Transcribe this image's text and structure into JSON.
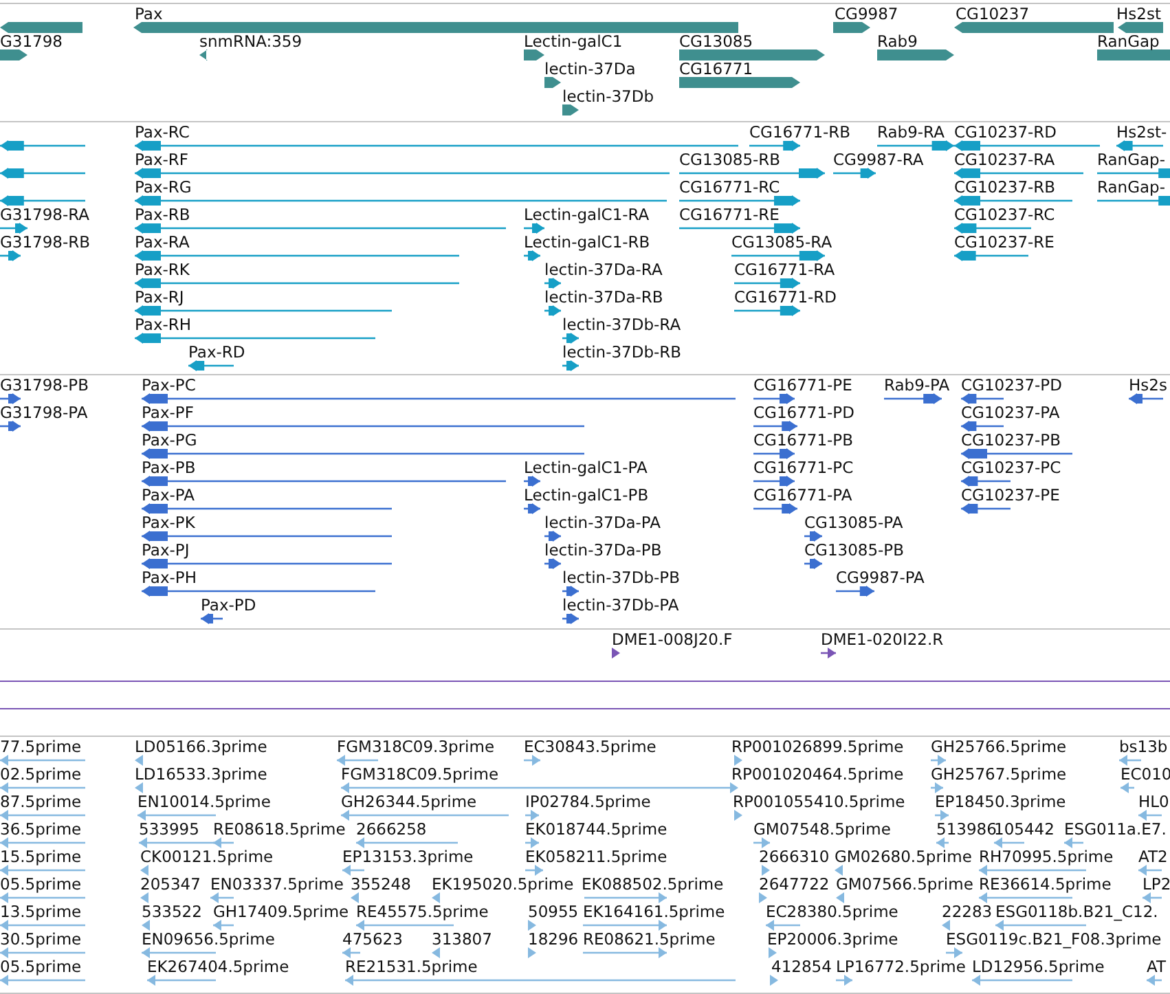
{
  "tracks": [
    {
      "kind": "gene",
      "color": "#3f8f8f",
      "features": [
        {
          "reverse": true
        },
        {
          "label": "Pax",
          "reverse": true
        },
        {
          "label": "CG9987",
          "reverse": false
        },
        {
          "label": "CG10237",
          "reverse": true
        },
        {
          "label": "Hs2st",
          "reverse": true
        },
        {
          "label": "G31798",
          "reverse": false
        },
        {
          "label": "snmRNA:359",
          "reverse": true
        },
        {
          "label": "Lectin-galC1",
          "reverse": false
        },
        {
          "label": "CG13085",
          "reverse": false
        },
        {
          "label": "Rab9",
          "reverse": false
        },
        {
          "label": "RanGap",
          "reverse": false
        },
        {
          "label": "lectin-37Da",
          "reverse": false
        },
        {
          "label": "CG16771",
          "reverse": false
        },
        {
          "label": "lectin-37Db",
          "reverse": false
        }
      ]
    },
    {
      "kind": "transcript",
      "color": "#169fc6",
      "features": [
        {
          "reverse": true
        },
        {
          "label": "Pax-RC",
          "reverse": true
        },
        {
          "label": "CG16771-RB",
          "reverse": false
        },
        {
          "label": "Rab9-RA",
          "reverse": false
        },
        {
          "label": "CG10237-RD",
          "reverse": true
        },
        {
          "label": "Hs2st-",
          "reverse": true
        },
        {
          "reverse": true
        },
        {
          "label": "Pax-RF",
          "reverse": true
        },
        {
          "label": "CG13085-RB",
          "reverse": false
        },
        {
          "label": "CG9987-RA",
          "reverse": false
        },
        {
          "label": "CG10237-RA",
          "reverse": true
        },
        {
          "label": "RanGap-",
          "reverse": false
        },
        {
          "reverse": true
        },
        {
          "label": "Pax-RG",
          "reverse": true
        },
        {
          "label": "CG16771-RC",
          "reverse": false
        },
        {
          "label": "CG10237-RB",
          "reverse": true
        },
        {
          "label": "RanGap-",
          "reverse": false
        },
        {
          "label": "G31798-RA",
          "reverse": false
        },
        {
          "label": "Pax-RB",
          "reverse": true
        },
        {
          "label": "Lectin-galC1-RA",
          "reverse": false
        },
        {
          "label": "CG16771-RE",
          "reverse": false
        },
        {
          "label": "CG10237-RC",
          "reverse": true
        },
        {
          "label": "G31798-RB",
          "reverse": false
        },
        {
          "label": "Pax-RA",
          "reverse": true
        },
        {
          "label": "Lectin-galC1-RB",
          "reverse": false
        },
        {
          "label": "CG13085-RA",
          "reverse": false
        },
        {
          "label": "CG10237-RE",
          "reverse": true
        },
        {
          "label": "Pax-RK",
          "reverse": true
        },
        {
          "label": "lectin-37Da-RA",
          "reverse": false
        },
        {
          "label": "CG16771-RA",
          "reverse": false
        },
        {
          "label": "Pax-RJ",
          "reverse": true
        },
        {
          "label": "lectin-37Da-RB",
          "reverse": false
        },
        {
          "label": "CG16771-RD",
          "reverse": false
        },
        {
          "label": "Pax-RH",
          "reverse": true
        },
        {
          "label": "lectin-37Db-RA",
          "reverse": false
        },
        {
          "label": "Pax-RD",
          "reverse": true
        },
        {
          "label": "lectin-37Db-RB",
          "reverse": false
        }
      ]
    },
    {
      "kind": "protein",
      "color": "#3b6fd0",
      "features": [
        {
          "label": "G31798-PB",
          "reverse": false
        },
        {
          "label": "Pax-PC",
          "reverse": true
        },
        {
          "label": "CG16771-PE",
          "reverse": false
        },
        {
          "label": "Rab9-PA",
          "reverse": false
        },
        {
          "label": "CG10237-PD",
          "reverse": true
        },
        {
          "label": "Hs2s",
          "reverse": true
        },
        {
          "label": "G31798-PA",
          "reverse": false
        },
        {
          "label": "Pax-PF",
          "reverse": true
        },
        {
          "label": "CG16771-PD",
          "reverse": false
        },
        {
          "label": "CG10237-PA",
          "reverse": true
        },
        {
          "label": "Pax-PG",
          "reverse": true
        },
        {
          "label": "CG16771-PB",
          "reverse": false
        },
        {
          "label": "CG10237-PB",
          "reverse": true
        },
        {
          "label": "Pax-PB",
          "reverse": true
        },
        {
          "label": "Lectin-galC1-PA",
          "reverse": false
        },
        {
          "label": "CG16771-PC",
          "reverse": false
        },
        {
          "label": "CG10237-PC",
          "reverse": true
        },
        {
          "label": "Pax-PA",
          "reverse": true
        },
        {
          "label": "Lectin-galC1-PB",
          "reverse": false
        },
        {
          "label": "CG16771-PA",
          "reverse": false
        },
        {
          "label": "CG10237-PE",
          "reverse": true
        },
        {
          "label": "Pax-PK",
          "reverse": true
        },
        {
          "label": "lectin-37Da-PA",
          "reverse": false
        },
        {
          "label": "CG13085-PA",
          "reverse": false
        },
        {
          "label": "Pax-PJ",
          "reverse": true
        },
        {
          "label": "lectin-37Da-PB",
          "reverse": false
        },
        {
          "label": "CG13085-PB",
          "reverse": false
        },
        {
          "label": "Pax-PH",
          "reverse": true
        },
        {
          "label": "lectin-37Db-PB",
          "reverse": false
        },
        {
          "label": "CG9987-PA",
          "reverse": false
        },
        {
          "label": "Pax-PD",
          "reverse": true
        },
        {
          "label": "lectin-37Db-PA",
          "reverse": false
        }
      ]
    },
    {
      "kind": "clone",
      "color": "#7a55b5",
      "features": [
        {
          "label": "DME1-008J20.F",
          "reverse": false
        },
        {
          "label": "DME1-020I22.R",
          "reverse": false
        }
      ]
    },
    {
      "kind": "est",
      "color": "#86b9e0",
      "features": [
        {
          "label": "77.5prime",
          "reverse": true
        },
        {
          "label": "LD05166.3prime",
          "reverse": true
        },
        {
          "label": "FGM318C09.3prime",
          "reverse": true
        },
        {
          "label": "EC30843.5prime",
          "reverse": false
        },
        {
          "label": "RP001026899.5prime",
          "reverse": false
        },
        {
          "label": "GH25766.5prime",
          "reverse": false
        },
        {
          "label": "bs13b",
          "reverse": true
        },
        {
          "label": "02.5prime",
          "reverse": true
        },
        {
          "label": "LD16533.3prime",
          "reverse": true
        },
        {
          "label": "FGM318C09.5prime",
          "reverse": true
        },
        {
          "label": "RP001020464.5prime",
          "reverse": false
        },
        {
          "label": "GH25767.5prime",
          "reverse": false
        },
        {
          "label": "EC010",
          "reverse": true
        },
        {
          "label": "87.5prime",
          "reverse": true
        },
        {
          "label": "EN10014.5prime",
          "reverse": true
        },
        {
          "label": "GH26344.5prime",
          "reverse": true
        },
        {
          "label": "IP02784.5prime",
          "reverse": false
        },
        {
          "label": "RP001055410.5prime",
          "reverse": false
        },
        {
          "label": "EP18450.3prime",
          "reverse": false
        },
        {
          "label": "HL0",
          "reverse": true
        },
        {
          "label": "36.5prime",
          "reverse": true
        },
        {
          "label": "533995",
          "reverse": true
        },
        {
          "label": "RE08618.5prime",
          "reverse": true
        },
        {
          "label": "2666258",
          "reverse": true
        },
        {
          "label": "EK018744.5prime",
          "reverse": false
        },
        {
          "label": "GM07548.5prime",
          "reverse": false
        },
        {
          "label": "513986",
          "reverse": true
        },
        {
          "label": "105442",
          "reverse": true
        },
        {
          "label": "ESG011a.E7.",
          "reverse": true
        },
        {
          "label": "15.5prime",
          "reverse": true
        },
        {
          "label": "CK00121.5prime",
          "reverse": true
        },
        {
          "label": "EP13153.3prime",
          "reverse": true
        },
        {
          "label": "EK058211.5prime",
          "reverse": false
        },
        {
          "label": "2666310",
          "reverse": false
        },
        {
          "label": "GM02680.5prime",
          "reverse": true
        },
        {
          "label": "RH70995.5prime",
          "reverse": true
        },
        {
          "label": "AT2",
          "reverse": true
        },
        {
          "label": "05.5prime",
          "reverse": true
        },
        {
          "label": "205347",
          "reverse": true
        },
        {
          "label": "EN03337.5prime",
          "reverse": true
        },
        {
          "label": "355248",
          "reverse": true
        },
        {
          "label": "EK195020.5prime",
          "reverse": true
        },
        {
          "label": "EK088502.5prime",
          "reverse": false
        },
        {
          "label": "2647722",
          "reverse": false
        },
        {
          "label": "GM07566.5prime",
          "reverse": true
        },
        {
          "label": "RE36614.5prime",
          "reverse": true
        },
        {
          "label": "LP2",
          "reverse": true
        },
        {
          "label": "13.5prime",
          "reverse": true
        },
        {
          "label": "533522",
          "reverse": true
        },
        {
          "label": "GH17409.5prime",
          "reverse": true
        },
        {
          "label": "RE45575.5prime",
          "reverse": true
        },
        {
          "label": "50955",
          "reverse": false
        },
        {
          "label": "EK164161.5prime",
          "reverse": false
        },
        {
          "label": "EC28380.5prime",
          "reverse": true
        },
        {
          "label": "22283",
          "reverse": true
        },
        {
          "label": "ESG0118b.B21_C12.",
          "reverse": true
        },
        {
          "label": "30.5prime",
          "reverse": true
        },
        {
          "label": "EN09656.5prime",
          "reverse": true
        },
        {
          "label": "475623",
          "reverse": true
        },
        {
          "label": "313807",
          "reverse": true
        },
        {
          "label": "18296",
          "reverse": false
        },
        {
          "label": "RE08621.5prime",
          "reverse": false
        },
        {
          "label": "EP20006.3prime",
          "reverse": false
        },
        {
          "label": "ESG0119c.B21_F08.3prime",
          "reverse": false
        },
        {
          "label": "05.5prime",
          "reverse": true
        },
        {
          "label": "EK267404.5prime",
          "reverse": true
        },
        {
          "label": "RE21531.5prime",
          "reverse": true
        },
        {
          "label": "412854",
          "reverse": false
        },
        {
          "label": "LP16772.5prime",
          "reverse": false
        },
        {
          "label": "LD12956.5prime",
          "reverse": true
        },
        {
          "label": "AT",
          "reverse": true
        }
      ]
    }
  ]
}
